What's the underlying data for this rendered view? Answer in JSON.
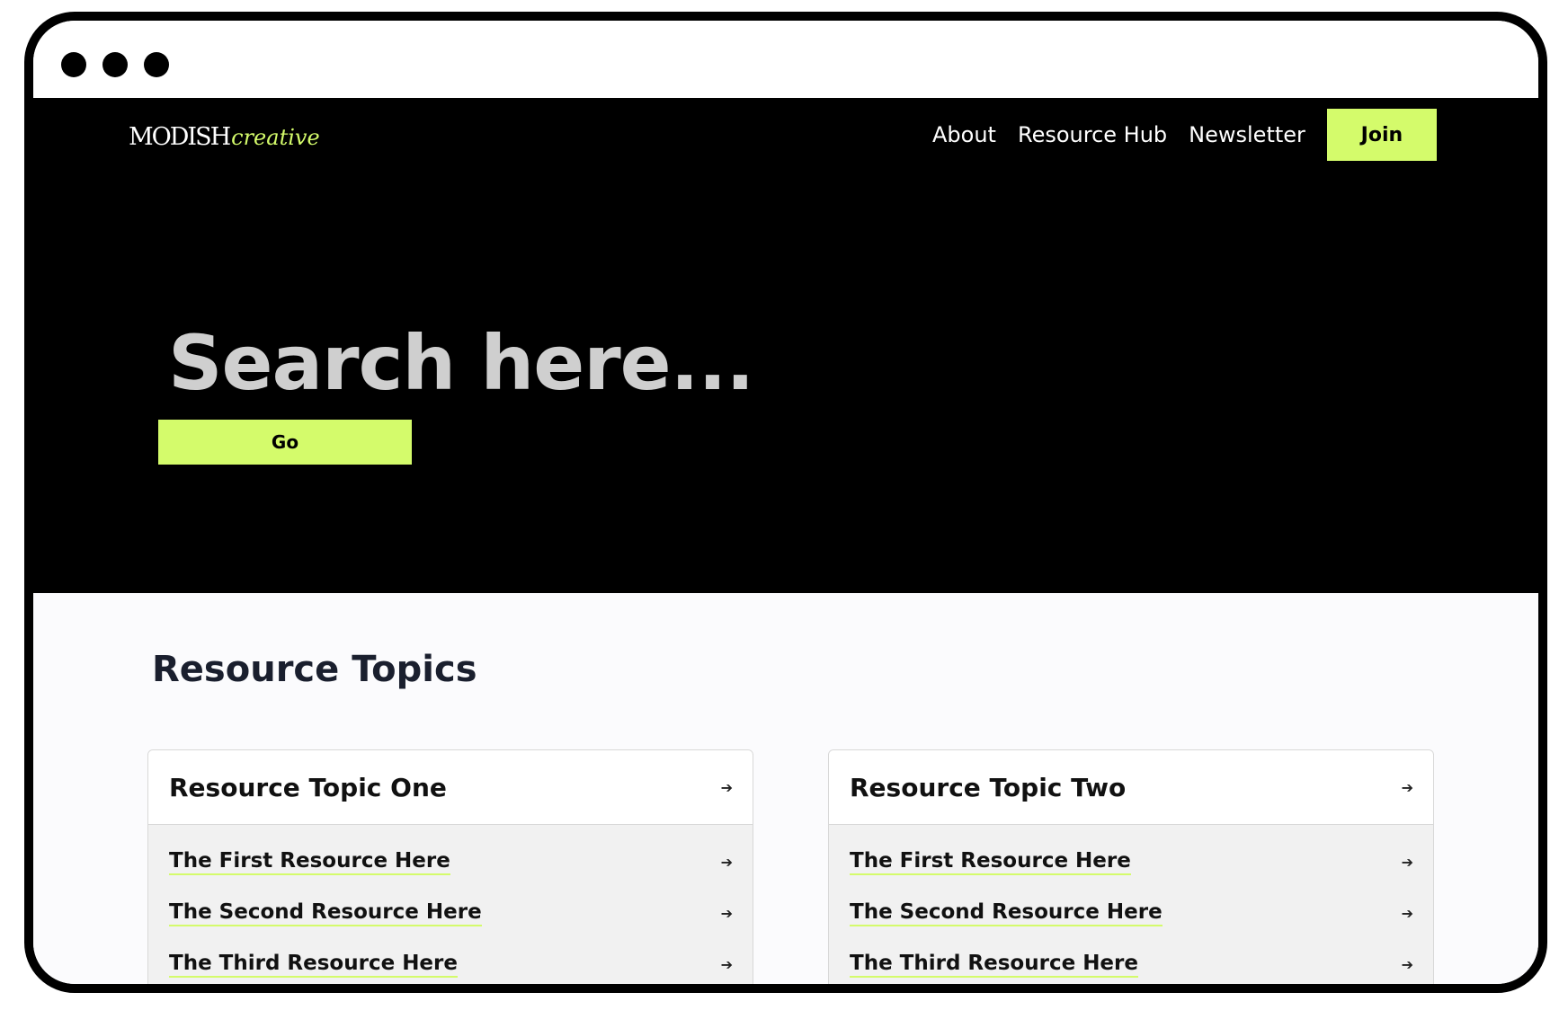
{
  "colors": {
    "accent": "#d4fb6b",
    "hero_bg": "#000000",
    "section_bg": "#fbfbfd",
    "card_bg": "#f1f1f1"
  },
  "window": {
    "controls": [
      "close-dot",
      "minimize-dot",
      "maximize-dot"
    ]
  },
  "header": {
    "logo": {
      "main": "MODISH",
      "accent": "creative"
    },
    "nav": [
      "About",
      "Resource Hub",
      "Newsletter"
    ],
    "join_label": "Join"
  },
  "hero": {
    "search_placeholder": "Search here...",
    "go_label": "Go"
  },
  "topics": {
    "title": "Resource Topics",
    "cards": [
      {
        "title": "Resource Topic One",
        "items": [
          "The First Resource Here",
          "The Second Resource Here",
          "The Third Resource Here"
        ]
      },
      {
        "title": "Resource Topic Two",
        "items": [
          "The First Resource Here",
          "The Second Resource Here",
          "The Third Resource Here"
        ]
      }
    ]
  },
  "icons": {
    "arrow": "arrow-right-icon"
  }
}
